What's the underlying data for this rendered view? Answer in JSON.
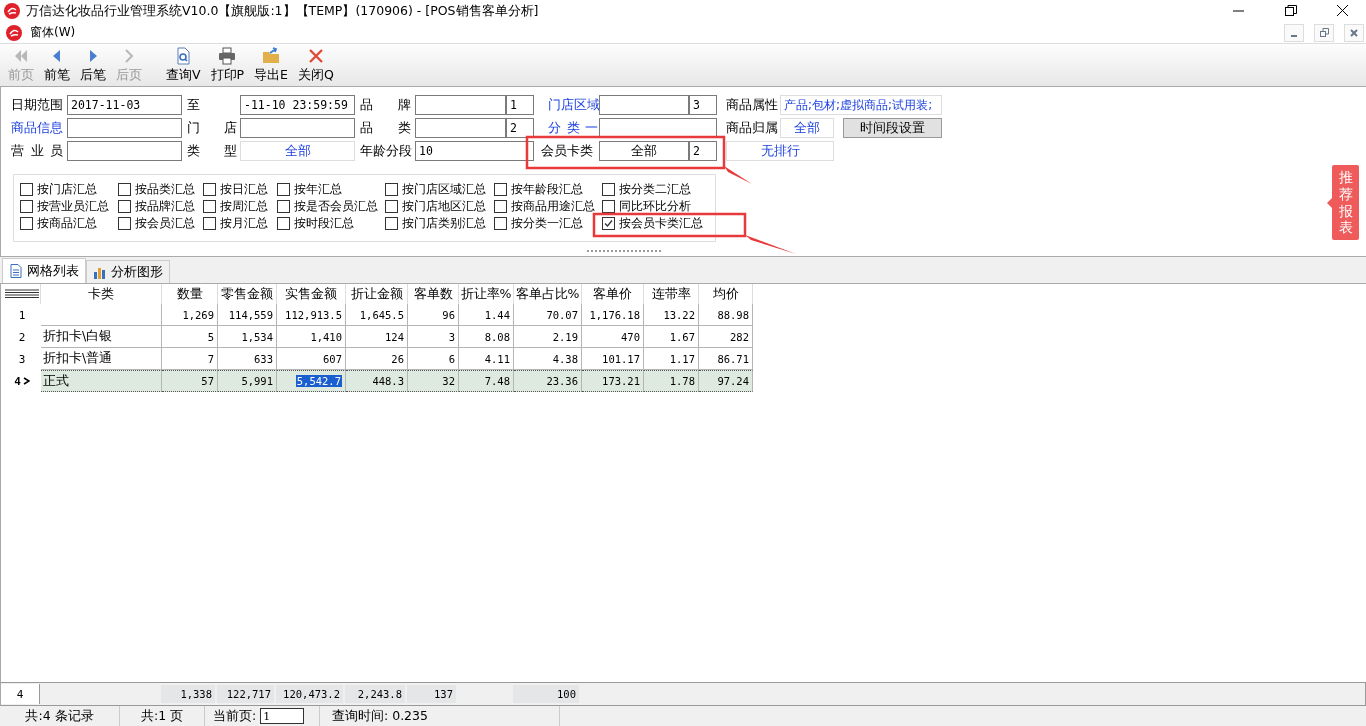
{
  "window": {
    "title": "万信达化妆品行业管理系统V10.0【旗舰版:1】【TEMP】(170906) - [POS销售客单分析]",
    "menu": "窗体(W)"
  },
  "toolbar": [
    {
      "label": "前页",
      "disabled": true
    },
    {
      "label": "前笔",
      "disabled": false
    },
    {
      "label": "后笔",
      "disabled": false
    },
    {
      "label": "后页",
      "disabled": true
    },
    {
      "label": "查询V",
      "disabled": false
    },
    {
      "label": "打印P",
      "disabled": false
    },
    {
      "label": "导出E",
      "disabled": false
    },
    {
      "label": "关闭Q",
      "disabled": false
    }
  ],
  "filters": [
    [
      {
        "kind": "label",
        "text": "日期范围"
      },
      {
        "kind": "input",
        "text": "2017-11-03"
      },
      {
        "kind": "label",
        "text": "至"
      },
      {
        "kind": "input",
        "text": "-11-10 23:59:59"
      },
      {
        "kind": "spread",
        "text": "品牌"
      },
      {
        "kind": "input"
      },
      {
        "kind": "input",
        "text": "1"
      },
      {
        "kind": "link",
        "text": "门店区域"
      },
      {
        "kind": "input"
      },
      {
        "kind": "input",
        "text": "3"
      },
      {
        "kind": "label",
        "text": "商品属性"
      },
      {
        "kind": "tags",
        "text": "产品;包材;虚拟商品;试用装;"
      }
    ],
    [
      {
        "kind": "link",
        "text": "商品信息"
      },
      {
        "kind": "input"
      },
      {
        "kind": "spread",
        "text": "门店"
      },
      {
        "kind": "input"
      },
      {
        "kind": "spread",
        "text": "品类"
      },
      {
        "kind": "input"
      },
      {
        "kind": "input",
        "text": "2"
      },
      {
        "kind": "spreadlink",
        "text": "分类一"
      },
      {
        "kind": "input"
      },
      {
        "kind": "label",
        "text": "商品归属"
      },
      {
        "kind": "picker",
        "text": "全部"
      },
      {
        "kind": "button",
        "text": "时间段设置"
      }
    ],
    [
      {
        "kind": "spread",
        "text": "营业员"
      },
      {
        "kind": "input"
      },
      {
        "kind": "spread",
        "text": "类型"
      },
      {
        "kind": "picker",
        "text": "全部"
      },
      {
        "kind": "label",
        "text": "年龄分段"
      },
      {
        "kind": "input",
        "text": "10"
      },
      {
        "kind": "label",
        "text": "会员卡类"
      },
      {
        "kind": "choice",
        "text": "全部"
      },
      {
        "kind": "input",
        "text": "2"
      },
      {
        "kind": "picker",
        "text": "无排行"
      }
    ]
  ],
  "options": [
    {
      "label": "按门店汇总",
      "checked": false
    },
    {
      "label": "按品类汇总",
      "checked": false
    },
    {
      "label": "按日汇总",
      "checked": false
    },
    {
      "label": "按年汇总",
      "checked": false
    },
    {
      "label": "按门店区域汇总",
      "checked": false
    },
    {
      "label": "按年龄段汇总",
      "checked": false
    },
    {
      "label": "按分类二汇总",
      "checked": false
    },
    {
      "label": "按营业员汇总",
      "checked": false
    },
    {
      "label": "按品牌汇总",
      "checked": false
    },
    {
      "label": "按周汇总",
      "checked": false
    },
    {
      "label": "按是否会员汇总",
      "checked": false
    },
    {
      "label": "按门店地区汇总",
      "checked": false
    },
    {
      "label": "按商品用途汇总",
      "checked": false
    },
    {
      "label": "同比环比分析",
      "checked": false
    },
    {
      "label": "按商品汇总",
      "checked": false
    },
    {
      "label": "按会员汇总",
      "checked": false
    },
    {
      "label": "按月汇总",
      "checked": false
    },
    {
      "label": "按时段汇总",
      "checked": false
    },
    {
      "label": "按门店类别汇总",
      "checked": false
    },
    {
      "label": "按分类一汇总",
      "checked": false
    },
    {
      "label": "按会员卡类汇总",
      "checked": true
    }
  ],
  "side_tab": "推荐报表",
  "tabs": [
    {
      "label": "网格列表",
      "selected": true
    },
    {
      "label": "分析图形",
      "selected": false
    }
  ],
  "table": {
    "columns": [
      "卡类",
      "数量",
      "零售金额",
      "实售金额",
      "折让金额",
      "客单数",
      "折让率%",
      "客单占比%",
      "客单价",
      "连带率",
      "均价"
    ],
    "rows": [
      {
        "num": "1",
        "selected": false,
        "cells": [
          {
            "text": null,
            "focused": false
          },
          {
            "text": "1,269",
            "focused": false
          },
          {
            "text": "114,559",
            "focused": false
          },
          {
            "text": "112,913.5",
            "focused": false
          },
          {
            "text": "1,645.5",
            "focused": false
          },
          {
            "text": "96",
            "focused": false
          },
          {
            "text": "1.44",
            "focused": false
          },
          {
            "text": "70.07",
            "focused": false
          },
          {
            "text": "1,176.18",
            "focused": false
          },
          {
            "text": "13.22",
            "focused": false
          },
          {
            "text": "88.98",
            "focused": false
          }
        ]
      },
      {
        "num": "2",
        "selected": false,
        "cells": [
          {
            "text": "折扣卡\\白银",
            "focused": false
          },
          {
            "text": "5",
            "focused": false
          },
          {
            "text": "1,534",
            "focused": false
          },
          {
            "text": "1,410",
            "focused": false
          },
          {
            "text": "124",
            "focused": false
          },
          {
            "text": "3",
            "focused": false
          },
          {
            "text": "8.08",
            "focused": false
          },
          {
            "text": "2.19",
            "focused": false
          },
          {
            "text": "470",
            "focused": false
          },
          {
            "text": "1.67",
            "focused": false
          },
          {
            "text": "282",
            "focused": false
          }
        ]
      },
      {
        "num": "3",
        "selected": false,
        "cells": [
          {
            "text": "折扣卡\\普通",
            "focused": false
          },
          {
            "text": "7",
            "focused": false
          },
          {
            "text": "633",
            "focused": false
          },
          {
            "text": "607",
            "focused": false
          },
          {
            "text": "26",
            "focused": false
          },
          {
            "text": "6",
            "focused": false
          },
          {
            "text": "4.11",
            "focused": false
          },
          {
            "text": "4.38",
            "focused": false
          },
          {
            "text": "101.17",
            "focused": false
          },
          {
            "text": "1.17",
            "focused": false
          },
          {
            "text": "86.71",
            "focused": false
          }
        ]
      },
      {
        "num": "4",
        "selected": true,
        "cells": [
          {
            "text": "正式",
            "focused": false
          },
          {
            "text": "57",
            "focused": false
          },
          {
            "text": "5,991",
            "focused": false
          },
          {
            "text": "5,542.7",
            "focused": true
          },
          {
            "text": "448.3",
            "focused": false
          },
          {
            "text": "32",
            "focused": false
          },
          {
            "text": "7.48",
            "focused": false
          },
          {
            "text": "23.36",
            "focused": false
          },
          {
            "text": "173.21",
            "focused": false
          },
          {
            "text": "1.78",
            "focused": false
          },
          {
            "text": "97.24",
            "focused": false
          }
        ]
      }
    ],
    "totals_count": "4",
    "totals": {
      "quantity": "1,338",
      "retail_amount": "122,717",
      "sales_amount": "120,473.2",
      "discount_amount": "2,243.8",
      "order_count": "137",
      "order_share": "100"
    }
  },
  "status_bar": {
    "records": "共:4 条记录",
    "pages": "共:1 页",
    "current_page_label": "当前页:",
    "current_page": "1",
    "query_time": "查询时间: 0.235"
  }
}
